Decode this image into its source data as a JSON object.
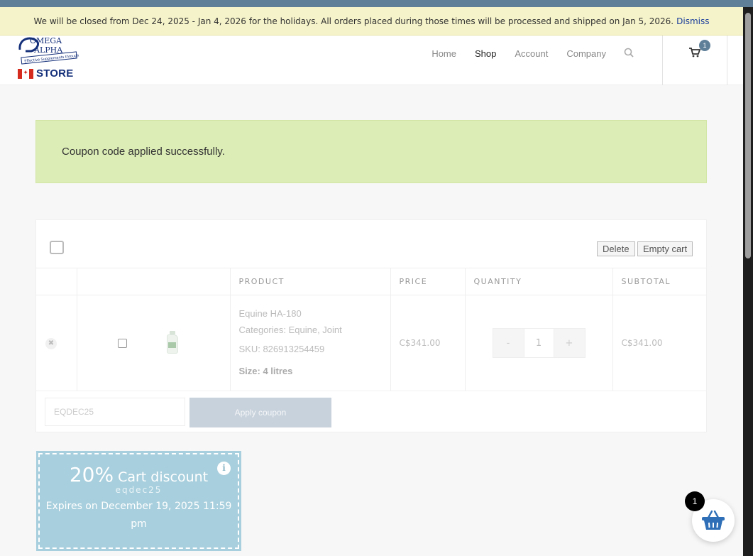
{
  "notice": {
    "text": "We will be closed from Dec 24, 2025 - Jan 4, 2026 for the holidays. All orders placed during those times will be processed and shipped on Jan 5, 2026.",
    "dismiss": "Dismiss"
  },
  "logo": {
    "line1": "OMEGA",
    "line2": "ALPHA",
    "tagline": "Effective Supplements through Science",
    "store": "STORE"
  },
  "nav": {
    "items": [
      "Home",
      "Shop",
      "Account",
      "Company"
    ],
    "active": "Shop",
    "cart_count": "1"
  },
  "message": {
    "text": "Coupon code applied successfully."
  },
  "cart": {
    "delete_label": "Delete",
    "empty_label": "Empty cart",
    "columns": [
      "",
      "",
      "PRODUCT",
      "PRICE",
      "QUANTITY",
      "SUBTOTAL"
    ],
    "item": {
      "name": "Equine HA-180",
      "categories_label": "Categories:",
      "categories": "Equine, Joint",
      "sku": "SKU: 826913254459",
      "size": "Size: 4 litres",
      "price": "C$341.00",
      "quantity": "1",
      "minus": "-",
      "plus": "+",
      "subtotal": "C$341.00"
    },
    "coupon_input_value": "EQDEC25",
    "apply_label": "Apply coupon"
  },
  "coupon_card": {
    "amount": "20%",
    "type": "Cart discount",
    "code": "eqdec25",
    "expires": "Expires on December 19, 2025 11:59 pm",
    "info": "i"
  },
  "floating_cart": {
    "count": "1"
  },
  "colors": {
    "accent": "#5f7f99",
    "notice_bg": "#f5f3c9",
    "success_bg": "#dcedb6",
    "coupon_bg": "#a8cfdd",
    "basket": "#2e6fb7"
  }
}
